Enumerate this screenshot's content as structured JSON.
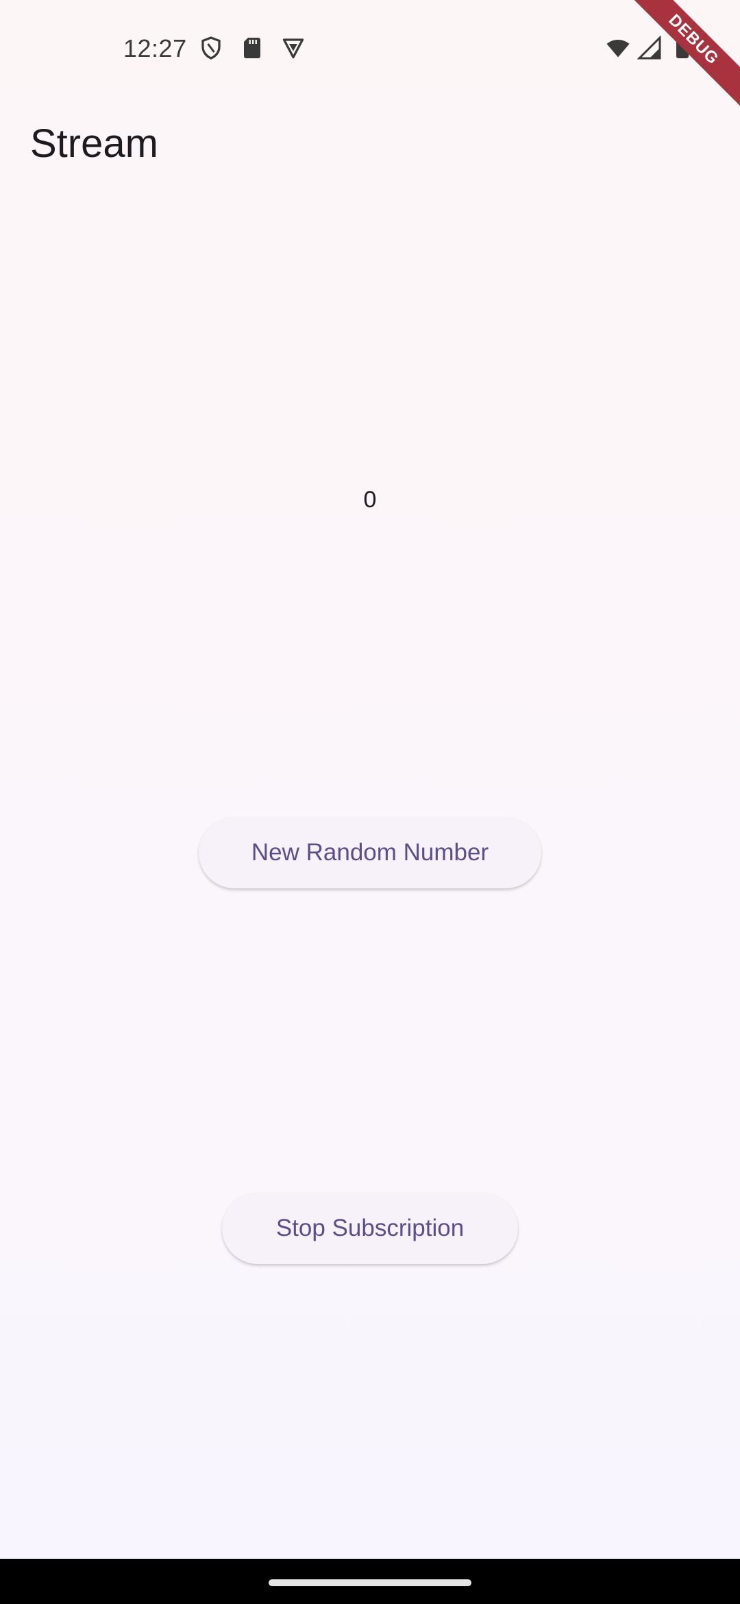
{
  "status_bar": {
    "time": "12:27",
    "left_icons": [
      "shield-icon",
      "sd-card-icon",
      "vpn-shield-icon"
    ],
    "right_icons": [
      "wifi-icon",
      "signal-icon",
      "battery-icon"
    ]
  },
  "debug_banner": {
    "label": "DEBUG",
    "color": "#a8323e"
  },
  "app_bar": {
    "title": "Stream"
  },
  "main": {
    "counter_value": "0",
    "new_random_button_label": "New Random Number",
    "stop_subscription_button_label": "Stop Subscription"
  },
  "colors": {
    "button_text": "#5b4e8a",
    "button_bg": "#f7f1fa",
    "background": "#fdf6f7"
  }
}
